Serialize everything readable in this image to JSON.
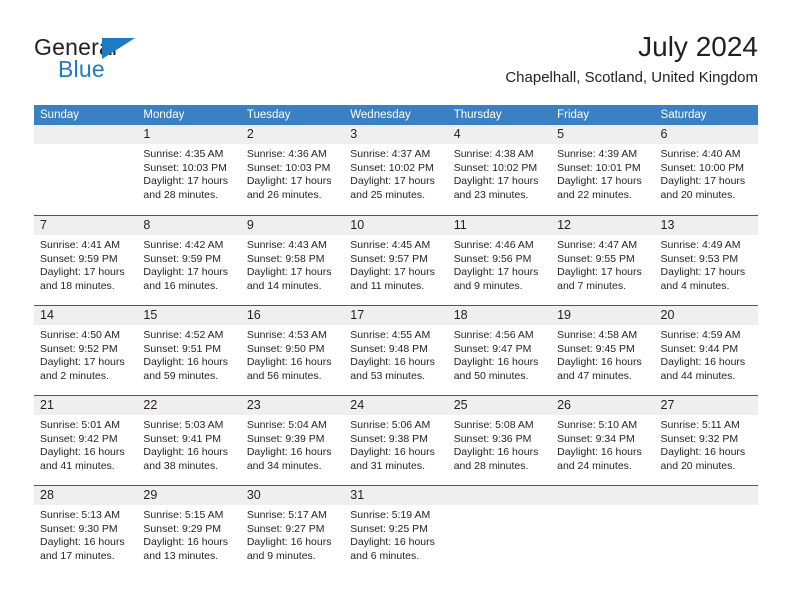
{
  "logo": {
    "word_top": "General",
    "word_bottom": "Blue",
    "accent_color": "#1f7ac4",
    "text_color": "#231f20"
  },
  "header": {
    "title": "July 2024",
    "subtitle": "Chapelhall, Scotland, United Kingdom"
  },
  "calendar": {
    "header_bg": "#3981c2",
    "header_text_color": "#ffffff",
    "week_separator_color": "#1d64a4",
    "day_band_bg": "#efefef",
    "weekdays": [
      "Sunday",
      "Monday",
      "Tuesday",
      "Wednesday",
      "Thursday",
      "Friday",
      "Saturday"
    ],
    "weeks": [
      [
        {
          "day": "",
          "sunrise": "",
          "sunset": "",
          "daylight_line1": "",
          "daylight_line2": ""
        },
        {
          "day": "1",
          "sunrise": "Sunrise: 4:35 AM",
          "sunset": "Sunset: 10:03 PM",
          "daylight_line1": "Daylight: 17 hours",
          "daylight_line2": "and 28 minutes."
        },
        {
          "day": "2",
          "sunrise": "Sunrise: 4:36 AM",
          "sunset": "Sunset: 10:03 PM",
          "daylight_line1": "Daylight: 17 hours",
          "daylight_line2": "and 26 minutes."
        },
        {
          "day": "3",
          "sunrise": "Sunrise: 4:37 AM",
          "sunset": "Sunset: 10:02 PM",
          "daylight_line1": "Daylight: 17 hours",
          "daylight_line2": "and 25 minutes."
        },
        {
          "day": "4",
          "sunrise": "Sunrise: 4:38 AM",
          "sunset": "Sunset: 10:02 PM",
          "daylight_line1": "Daylight: 17 hours",
          "daylight_line2": "and 23 minutes."
        },
        {
          "day": "5",
          "sunrise": "Sunrise: 4:39 AM",
          "sunset": "Sunset: 10:01 PM",
          "daylight_line1": "Daylight: 17 hours",
          "daylight_line2": "and 22 minutes."
        },
        {
          "day": "6",
          "sunrise": "Sunrise: 4:40 AM",
          "sunset": "Sunset: 10:00 PM",
          "daylight_line1": "Daylight: 17 hours",
          "daylight_line2": "and 20 minutes."
        }
      ],
      [
        {
          "day": "7",
          "sunrise": "Sunrise: 4:41 AM",
          "sunset": "Sunset: 9:59 PM",
          "daylight_line1": "Daylight: 17 hours",
          "daylight_line2": "and 18 minutes."
        },
        {
          "day": "8",
          "sunrise": "Sunrise: 4:42 AM",
          "sunset": "Sunset: 9:59 PM",
          "daylight_line1": "Daylight: 17 hours",
          "daylight_line2": "and 16 minutes."
        },
        {
          "day": "9",
          "sunrise": "Sunrise: 4:43 AM",
          "sunset": "Sunset: 9:58 PM",
          "daylight_line1": "Daylight: 17 hours",
          "daylight_line2": "and 14 minutes."
        },
        {
          "day": "10",
          "sunrise": "Sunrise: 4:45 AM",
          "sunset": "Sunset: 9:57 PM",
          "daylight_line1": "Daylight: 17 hours",
          "daylight_line2": "and 11 minutes."
        },
        {
          "day": "11",
          "sunrise": "Sunrise: 4:46 AM",
          "sunset": "Sunset: 9:56 PM",
          "daylight_line1": "Daylight: 17 hours",
          "daylight_line2": "and 9 minutes."
        },
        {
          "day": "12",
          "sunrise": "Sunrise: 4:47 AM",
          "sunset": "Sunset: 9:55 PM",
          "daylight_line1": "Daylight: 17 hours",
          "daylight_line2": "and 7 minutes."
        },
        {
          "day": "13",
          "sunrise": "Sunrise: 4:49 AM",
          "sunset": "Sunset: 9:53 PM",
          "daylight_line1": "Daylight: 17 hours",
          "daylight_line2": "and 4 minutes."
        }
      ],
      [
        {
          "day": "14",
          "sunrise": "Sunrise: 4:50 AM",
          "sunset": "Sunset: 9:52 PM",
          "daylight_line1": "Daylight: 17 hours",
          "daylight_line2": "and 2 minutes."
        },
        {
          "day": "15",
          "sunrise": "Sunrise: 4:52 AM",
          "sunset": "Sunset: 9:51 PM",
          "daylight_line1": "Daylight: 16 hours",
          "daylight_line2": "and 59 minutes."
        },
        {
          "day": "16",
          "sunrise": "Sunrise: 4:53 AM",
          "sunset": "Sunset: 9:50 PM",
          "daylight_line1": "Daylight: 16 hours",
          "daylight_line2": "and 56 minutes."
        },
        {
          "day": "17",
          "sunrise": "Sunrise: 4:55 AM",
          "sunset": "Sunset: 9:48 PM",
          "daylight_line1": "Daylight: 16 hours",
          "daylight_line2": "and 53 minutes."
        },
        {
          "day": "18",
          "sunrise": "Sunrise: 4:56 AM",
          "sunset": "Sunset: 9:47 PM",
          "daylight_line1": "Daylight: 16 hours",
          "daylight_line2": "and 50 minutes."
        },
        {
          "day": "19",
          "sunrise": "Sunrise: 4:58 AM",
          "sunset": "Sunset: 9:45 PM",
          "daylight_line1": "Daylight: 16 hours",
          "daylight_line2": "and 47 minutes."
        },
        {
          "day": "20",
          "sunrise": "Sunrise: 4:59 AM",
          "sunset": "Sunset: 9:44 PM",
          "daylight_line1": "Daylight: 16 hours",
          "daylight_line2": "and 44 minutes."
        }
      ],
      [
        {
          "day": "21",
          "sunrise": "Sunrise: 5:01 AM",
          "sunset": "Sunset: 9:42 PM",
          "daylight_line1": "Daylight: 16 hours",
          "daylight_line2": "and 41 minutes."
        },
        {
          "day": "22",
          "sunrise": "Sunrise: 5:03 AM",
          "sunset": "Sunset: 9:41 PM",
          "daylight_line1": "Daylight: 16 hours",
          "daylight_line2": "and 38 minutes."
        },
        {
          "day": "23",
          "sunrise": "Sunrise: 5:04 AM",
          "sunset": "Sunset: 9:39 PM",
          "daylight_line1": "Daylight: 16 hours",
          "daylight_line2": "and 34 minutes."
        },
        {
          "day": "24",
          "sunrise": "Sunrise: 5:06 AM",
          "sunset": "Sunset: 9:38 PM",
          "daylight_line1": "Daylight: 16 hours",
          "daylight_line2": "and 31 minutes."
        },
        {
          "day": "25",
          "sunrise": "Sunrise: 5:08 AM",
          "sunset": "Sunset: 9:36 PM",
          "daylight_line1": "Daylight: 16 hours",
          "daylight_line2": "and 28 minutes."
        },
        {
          "day": "26",
          "sunrise": "Sunrise: 5:10 AM",
          "sunset": "Sunset: 9:34 PM",
          "daylight_line1": "Daylight: 16 hours",
          "daylight_line2": "and 24 minutes."
        },
        {
          "day": "27",
          "sunrise": "Sunrise: 5:11 AM",
          "sunset": "Sunset: 9:32 PM",
          "daylight_line1": "Daylight: 16 hours",
          "daylight_line2": "and 20 minutes."
        }
      ],
      [
        {
          "day": "28",
          "sunrise": "Sunrise: 5:13 AM",
          "sunset": "Sunset: 9:30 PM",
          "daylight_line1": "Daylight: 16 hours",
          "daylight_line2": "and 17 minutes."
        },
        {
          "day": "29",
          "sunrise": "Sunrise: 5:15 AM",
          "sunset": "Sunset: 9:29 PM",
          "daylight_line1": "Daylight: 16 hours",
          "daylight_line2": "and 13 minutes."
        },
        {
          "day": "30",
          "sunrise": "Sunrise: 5:17 AM",
          "sunset": "Sunset: 9:27 PM",
          "daylight_line1": "Daylight: 16 hours",
          "daylight_line2": "and 9 minutes."
        },
        {
          "day": "31",
          "sunrise": "Sunrise: 5:19 AM",
          "sunset": "Sunset: 9:25 PM",
          "daylight_line1": "Daylight: 16 hours",
          "daylight_line2": "and 6 minutes."
        },
        {
          "day": "",
          "sunrise": "",
          "sunset": "",
          "daylight_line1": "",
          "daylight_line2": ""
        },
        {
          "day": "",
          "sunrise": "",
          "sunset": "",
          "daylight_line1": "",
          "daylight_line2": ""
        },
        {
          "day": "",
          "sunrise": "",
          "sunset": "",
          "daylight_line1": "",
          "daylight_line2": ""
        }
      ]
    ]
  }
}
